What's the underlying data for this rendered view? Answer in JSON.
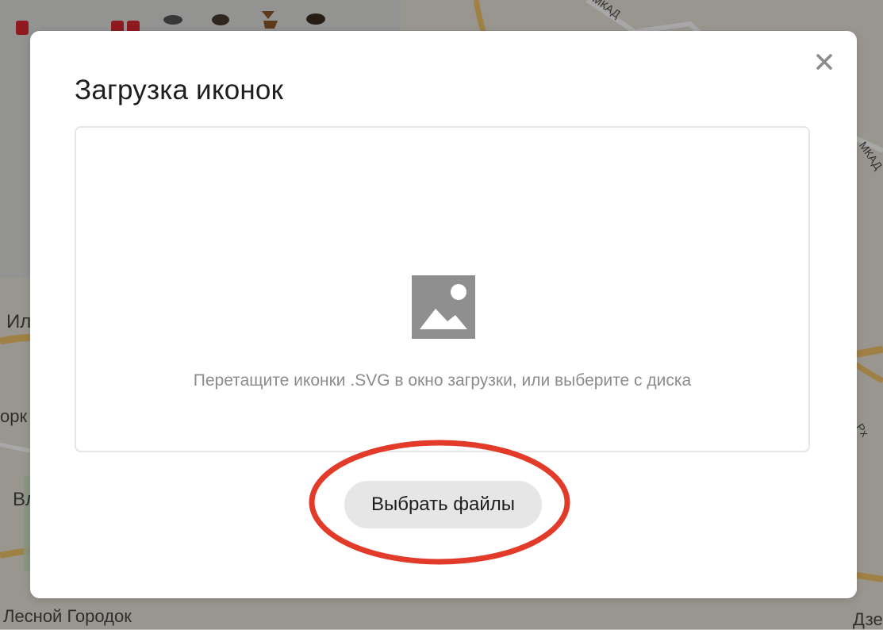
{
  "dialog": {
    "title": "Загрузка иконок",
    "close_label": "×",
    "dropzone": {
      "hint": "Перетащите иконки .SVG в окно загрузки, или выберите с диска",
      "icon": "image-placeholder-icon"
    },
    "choose_button_label": "Выбрать файлы"
  },
  "background_map": {
    "labels": {
      "forest_town": "Лесной Городок",
      "mkad_top": "МКАД",
      "mkad_right": "МКАД",
      "partial_il": "Ил",
      "partial_ork": "орк",
      "partial_v": "Вл",
      "partial_dz": "Дзе",
      "partial_rx": "Рх"
    }
  },
  "icon_palette": {
    "icons": [
      "metro-icon",
      "metro-icon",
      "metro-icon",
      "wolf-icon",
      "boar-icon",
      "deer-icon",
      "bear-icon"
    ]
  },
  "colors": {
    "annotation_ring": "#e23b2a",
    "button_bg": "#e6e6e6",
    "hint_text": "#8c8c8c",
    "icon_gray": "#8f8f8f"
  }
}
